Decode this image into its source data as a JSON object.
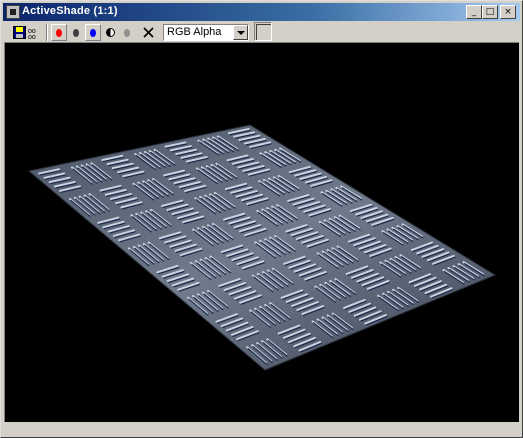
{
  "window": {
    "title": "ActiveShade (1:1)",
    "buttons": {
      "minimize_glyph": "_",
      "maximize_glyph": "□",
      "close_glyph": "×"
    }
  },
  "toolbar": {
    "tools": [
      {
        "name": "save-icon",
        "color": "#000080"
      },
      {
        "name": "clone-icon",
        "color": "#000000"
      },
      {
        "name": "red-channel-toggle",
        "color": "#ff0000"
      },
      {
        "name": "green-channel-toggle",
        "color": "#808080"
      },
      {
        "name": "blue-channel-toggle",
        "color": "#0000ff"
      },
      {
        "name": "alpha-channel-toggle",
        "color": "#404040"
      },
      {
        "name": "monochrome-toggle",
        "color": "#909090"
      },
      {
        "name": "clear-icon",
        "color": "#000000"
      }
    ],
    "channel_select": {
      "value": "RGB Alpha"
    },
    "color_swatch": {
      "color": "#d4d0c8"
    }
  },
  "viewport": {
    "background": "#000000",
    "content": "diamond-plate-plane-render"
  }
}
